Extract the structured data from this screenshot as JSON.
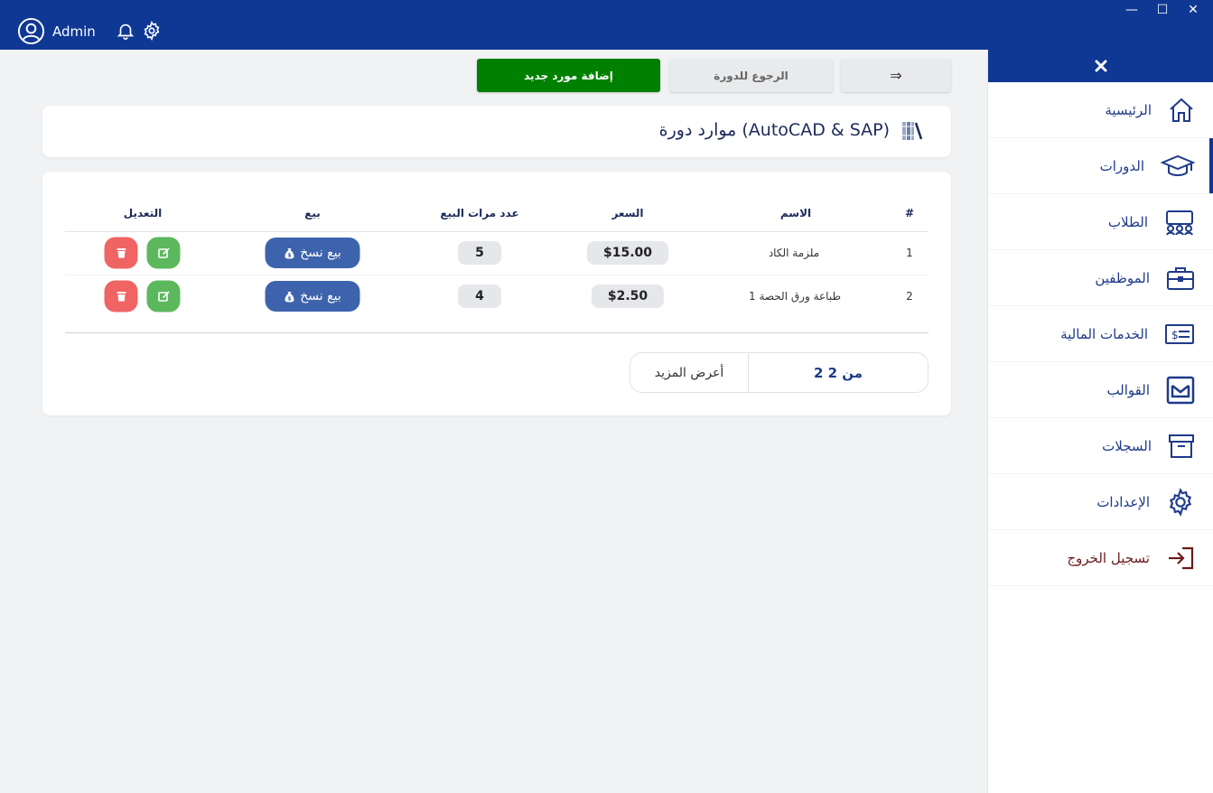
{
  "header": {
    "user_name": "Admin",
    "window": {
      "minimize": "—",
      "maximize": "☐",
      "close": "✕"
    }
  },
  "sidebar": {
    "close": "✕",
    "items": [
      {
        "label": "الرئيسية",
        "icon": "home-icon"
      },
      {
        "label": "الدورات",
        "icon": "graduation-cap-icon",
        "active": true
      },
      {
        "label": "الطلاب",
        "icon": "students-icon"
      },
      {
        "label": "الموظفين",
        "icon": "briefcase-icon"
      },
      {
        "label": "الخدمات المالية",
        "icon": "money-card-icon"
      },
      {
        "label": "القوالب",
        "icon": "envelope-icon"
      },
      {
        "label": "السجلات",
        "icon": "archive-icon"
      },
      {
        "label": "الإعدادات",
        "icon": "gear-icon"
      },
      {
        "label": "تسجيل الخروج",
        "icon": "logout-icon"
      }
    ]
  },
  "toolbar": {
    "arrow": "⇒",
    "back": "الرجوع للدورة",
    "add": "إضافة مورد جديد"
  },
  "page": {
    "title": "موارد دورة (AutoCAD & SAP)"
  },
  "table": {
    "columns": [
      "#",
      "الاسم",
      "السعر",
      "عدد مرات البيع",
      "بيع",
      "التعديل"
    ],
    "sell_label": "بيع نسخ",
    "rows": [
      {
        "num": "1",
        "name": "ملزمة الكاد",
        "price": "$15.00",
        "count": "5"
      },
      {
        "num": "2",
        "name": "طباعة ورق الحصة 1",
        "price": "$2.50",
        "count": "4"
      }
    ]
  },
  "pager": {
    "summary": "2 من 2",
    "more": "أعرض المزيد"
  },
  "colors": {
    "primary": "#0f3894",
    "add_button": "#008000",
    "sell_button": "#3d63ac",
    "edit_button": "#5cb85c",
    "delete_button": "#f06464"
  }
}
